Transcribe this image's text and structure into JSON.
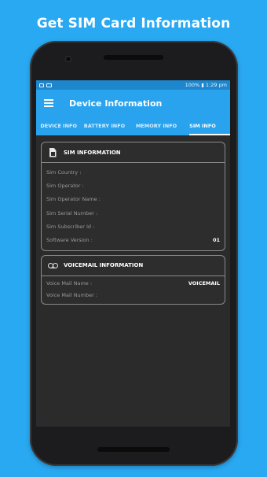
{
  "headline": "Get SIM Card Information",
  "statusbar": {
    "right": "100% ▮ 1:29 pm"
  },
  "appbar": {
    "title": "Device Information"
  },
  "tabs": [
    {
      "label": "DEVICE INFO"
    },
    {
      "label": "BATTERY INFO"
    },
    {
      "label": "MEMORY INFO"
    },
    {
      "label": "SIM INFO",
      "selected": true
    }
  ],
  "sim_card": {
    "title": "SIM INFORMATION",
    "icon": "sim-card-icon",
    "rows": [
      {
        "label": "Sim Country :",
        "value": ""
      },
      {
        "label": "Sim Operator :",
        "value": ""
      },
      {
        "label": "Sim Operator Name :",
        "value": ""
      },
      {
        "label": "Sim Serial Number :",
        "value": ""
      },
      {
        "label": "Sim Subscriber Id :",
        "value": ""
      },
      {
        "label": "Software Version :",
        "value": "01"
      }
    ]
  },
  "voicemail_card": {
    "title": "VOICEMAIL INFORMATION",
    "icon": "voicemail-icon",
    "rows": [
      {
        "label": "Voice Mail Name :",
        "value": "VOICEMAIL"
      },
      {
        "label": "Voice Mail Number :",
        "value": ""
      }
    ]
  },
  "colors": {
    "background": "#29a9f2",
    "appbar": "#29a3ee",
    "statusbar": "#1d86cc",
    "screen": "#2b2b2b"
  }
}
